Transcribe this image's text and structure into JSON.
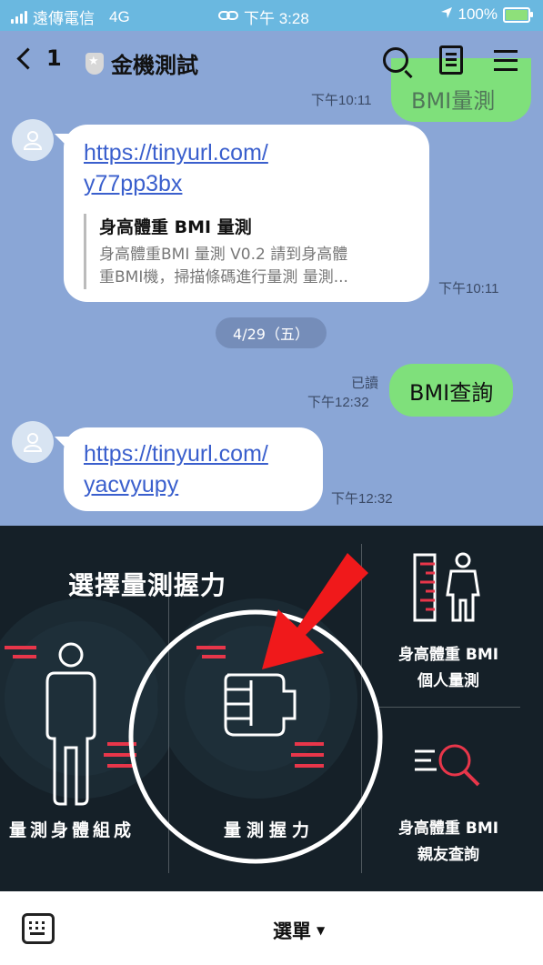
{
  "status_bar": {
    "carrier": "遠傳電信",
    "network": "4G",
    "time": "下午 3:28",
    "battery": "100%"
  },
  "header": {
    "back_count": "1",
    "title": "金機測試",
    "icons": [
      "search-icon",
      "notes-icon",
      "menu-icon"
    ]
  },
  "chat": {
    "top_partial_message": "BMI量測",
    "top_partial_time": "下午10:11",
    "incoming_1": {
      "link_line1": "https://tinyurl.com/",
      "link_line2": "y77pp3bx",
      "preview_title": "身高體重 BMI 量測",
      "preview_desc_line1": "身高體重BMI 量測 V0.2 請到身高體",
      "preview_desc_line2": "重BMI機，掃描條碼進行量測 量測...",
      "time": "下午10:11"
    },
    "date_separator": "4/29（五）",
    "outgoing_1": {
      "read_label": "已讀",
      "time": "下午12:32",
      "text": "BMI查詢"
    },
    "incoming_2": {
      "link_line1": "https://tinyurl.com/",
      "link_line2": "yacvyupy",
      "time": "下午12:32"
    }
  },
  "rich_menu": {
    "title": "選擇量測握力",
    "cell_body": "量測身體組成",
    "cell_grip": "量測握力",
    "cell_bmi_personal_line1": "身高體重 BMI",
    "cell_bmi_personal_line2": "個人量測",
    "cell_bmi_friend_line1": "身高體重 BMI",
    "cell_bmi_friend_line2": "親友查詢",
    "accent_color": "#e8364a",
    "highlight_arrow_color": "#f0191b"
  },
  "bottom_bar": {
    "menu_label": "選單"
  }
}
